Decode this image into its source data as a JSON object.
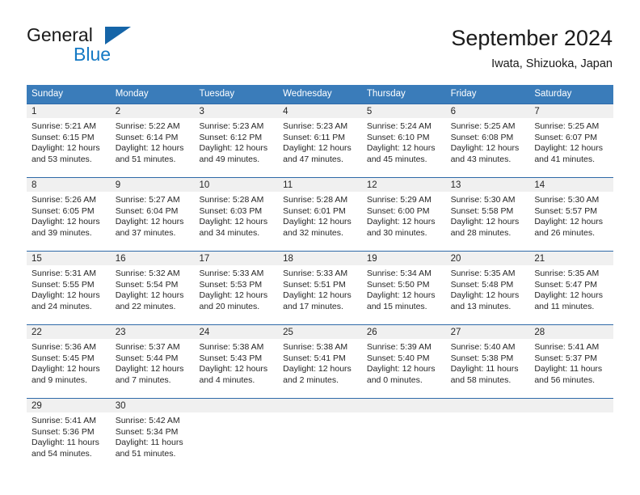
{
  "brand": {
    "name_primary": "General",
    "name_secondary": "Blue",
    "triangle_icon": "triangle-logo-icon"
  },
  "header": {
    "title": "September 2024",
    "location": "Iwata, Shizuoka, Japan"
  },
  "weekday_headers": [
    "Sunday",
    "Monday",
    "Tuesday",
    "Wednesday",
    "Thursday",
    "Friday",
    "Saturday"
  ],
  "colors": {
    "header_blue": "#3a7cba",
    "separator_blue": "#2f6aa8",
    "day_strip_gray": "#f0f0f0",
    "brand_blue": "#1479c4",
    "logo_blue": "#1565a8",
    "text": "#262626"
  },
  "labels": {
    "sunrise_prefix": "Sunrise:",
    "sunset_prefix": "Sunset:",
    "daylight_prefix": "Daylight:"
  },
  "weeks": [
    {
      "days": [
        {
          "date": "1",
          "sunrise": "Sunrise: 5:21 AM",
          "sunset": "Sunset: 6:15 PM",
          "daylight": "Daylight: 12 hours and 53 minutes."
        },
        {
          "date": "2",
          "sunrise": "Sunrise: 5:22 AM",
          "sunset": "Sunset: 6:14 PM",
          "daylight": "Daylight: 12 hours and 51 minutes."
        },
        {
          "date": "3",
          "sunrise": "Sunrise: 5:23 AM",
          "sunset": "Sunset: 6:12 PM",
          "daylight": "Daylight: 12 hours and 49 minutes."
        },
        {
          "date": "4",
          "sunrise": "Sunrise: 5:23 AM",
          "sunset": "Sunset: 6:11 PM",
          "daylight": "Daylight: 12 hours and 47 minutes."
        },
        {
          "date": "5",
          "sunrise": "Sunrise: 5:24 AM",
          "sunset": "Sunset: 6:10 PM",
          "daylight": "Daylight: 12 hours and 45 minutes."
        },
        {
          "date": "6",
          "sunrise": "Sunrise: 5:25 AM",
          "sunset": "Sunset: 6:08 PM",
          "daylight": "Daylight: 12 hours and 43 minutes."
        },
        {
          "date": "7",
          "sunrise": "Sunrise: 5:25 AM",
          "sunset": "Sunset: 6:07 PM",
          "daylight": "Daylight: 12 hours and 41 minutes."
        }
      ]
    },
    {
      "days": [
        {
          "date": "8",
          "sunrise": "Sunrise: 5:26 AM",
          "sunset": "Sunset: 6:05 PM",
          "daylight": "Daylight: 12 hours and 39 minutes."
        },
        {
          "date": "9",
          "sunrise": "Sunrise: 5:27 AM",
          "sunset": "Sunset: 6:04 PM",
          "daylight": "Daylight: 12 hours and 37 minutes."
        },
        {
          "date": "10",
          "sunrise": "Sunrise: 5:28 AM",
          "sunset": "Sunset: 6:03 PM",
          "daylight": "Daylight: 12 hours and 34 minutes."
        },
        {
          "date": "11",
          "sunrise": "Sunrise: 5:28 AM",
          "sunset": "Sunset: 6:01 PM",
          "daylight": "Daylight: 12 hours and 32 minutes."
        },
        {
          "date": "12",
          "sunrise": "Sunrise: 5:29 AM",
          "sunset": "Sunset: 6:00 PM",
          "daylight": "Daylight: 12 hours and 30 minutes."
        },
        {
          "date": "13",
          "sunrise": "Sunrise: 5:30 AM",
          "sunset": "Sunset: 5:58 PM",
          "daylight": "Daylight: 12 hours and 28 minutes."
        },
        {
          "date": "14",
          "sunrise": "Sunrise: 5:30 AM",
          "sunset": "Sunset: 5:57 PM",
          "daylight": "Daylight: 12 hours and 26 minutes."
        }
      ]
    },
    {
      "days": [
        {
          "date": "15",
          "sunrise": "Sunrise: 5:31 AM",
          "sunset": "Sunset: 5:55 PM",
          "daylight": "Daylight: 12 hours and 24 minutes."
        },
        {
          "date": "16",
          "sunrise": "Sunrise: 5:32 AM",
          "sunset": "Sunset: 5:54 PM",
          "daylight": "Daylight: 12 hours and 22 minutes."
        },
        {
          "date": "17",
          "sunrise": "Sunrise: 5:33 AM",
          "sunset": "Sunset: 5:53 PM",
          "daylight": "Daylight: 12 hours and 20 minutes."
        },
        {
          "date": "18",
          "sunrise": "Sunrise: 5:33 AM",
          "sunset": "Sunset: 5:51 PM",
          "daylight": "Daylight: 12 hours and 17 minutes."
        },
        {
          "date": "19",
          "sunrise": "Sunrise: 5:34 AM",
          "sunset": "Sunset: 5:50 PM",
          "daylight": "Daylight: 12 hours and 15 minutes."
        },
        {
          "date": "20",
          "sunrise": "Sunrise: 5:35 AM",
          "sunset": "Sunset: 5:48 PM",
          "daylight": "Daylight: 12 hours and 13 minutes."
        },
        {
          "date": "21",
          "sunrise": "Sunrise: 5:35 AM",
          "sunset": "Sunset: 5:47 PM",
          "daylight": "Daylight: 12 hours and 11 minutes."
        }
      ]
    },
    {
      "days": [
        {
          "date": "22",
          "sunrise": "Sunrise: 5:36 AM",
          "sunset": "Sunset: 5:45 PM",
          "daylight": "Daylight: 12 hours and 9 minutes."
        },
        {
          "date": "23",
          "sunrise": "Sunrise: 5:37 AM",
          "sunset": "Sunset: 5:44 PM",
          "daylight": "Daylight: 12 hours and 7 minutes."
        },
        {
          "date": "24",
          "sunrise": "Sunrise: 5:38 AM",
          "sunset": "Sunset: 5:43 PM",
          "daylight": "Daylight: 12 hours and 4 minutes."
        },
        {
          "date": "25",
          "sunrise": "Sunrise: 5:38 AM",
          "sunset": "Sunset: 5:41 PM",
          "daylight": "Daylight: 12 hours and 2 minutes."
        },
        {
          "date": "26",
          "sunrise": "Sunrise: 5:39 AM",
          "sunset": "Sunset: 5:40 PM",
          "daylight": "Daylight: 12 hours and 0 minutes."
        },
        {
          "date": "27",
          "sunrise": "Sunrise: 5:40 AM",
          "sunset": "Sunset: 5:38 PM",
          "daylight": "Daylight: 11 hours and 58 minutes."
        },
        {
          "date": "28",
          "sunrise": "Sunrise: 5:41 AM",
          "sunset": "Sunset: 5:37 PM",
          "daylight": "Daylight: 11 hours and 56 minutes."
        }
      ]
    },
    {
      "days": [
        {
          "date": "29",
          "sunrise": "Sunrise: 5:41 AM",
          "sunset": "Sunset: 5:36 PM",
          "daylight": "Daylight: 11 hours and 54 minutes."
        },
        {
          "date": "30",
          "sunrise": "Sunrise: 5:42 AM",
          "sunset": "Sunset: 5:34 PM",
          "daylight": "Daylight: 11 hours and 51 minutes."
        },
        {
          "date": "",
          "sunrise": "",
          "sunset": "",
          "daylight": ""
        },
        {
          "date": "",
          "sunrise": "",
          "sunset": "",
          "daylight": ""
        },
        {
          "date": "",
          "sunrise": "",
          "sunset": "",
          "daylight": ""
        },
        {
          "date": "",
          "sunrise": "",
          "sunset": "",
          "daylight": ""
        },
        {
          "date": "",
          "sunrise": "",
          "sunset": "",
          "daylight": ""
        }
      ]
    }
  ]
}
